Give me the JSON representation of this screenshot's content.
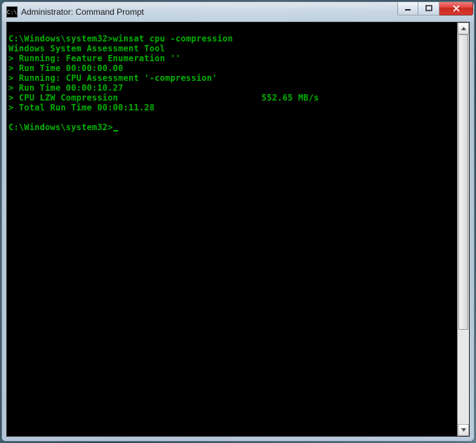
{
  "window": {
    "title": "Administrator: Command Prompt",
    "icon_label": "C:\\"
  },
  "terminal": {
    "prompt1_path": "C:\\Windows\\system32>",
    "prompt1_cmd": "winsat cpu -compression",
    "line_tool": "Windows System Assessment Tool",
    "line_feat": "> Running: Feature Enumeration ''",
    "line_rt1": "> Run Time 00:00:00.00",
    "line_cpua": "> Running: CPU Assessment '-compression'",
    "line_rt2": "> Run Time 00:00:10.27",
    "line_comp_label": "> CPU LZW Compression",
    "line_comp_value": "552.65 MB/s",
    "line_total": "> Total Run Time 00:00:11.28",
    "prompt2_path": "C:\\Windows\\system32>"
  }
}
